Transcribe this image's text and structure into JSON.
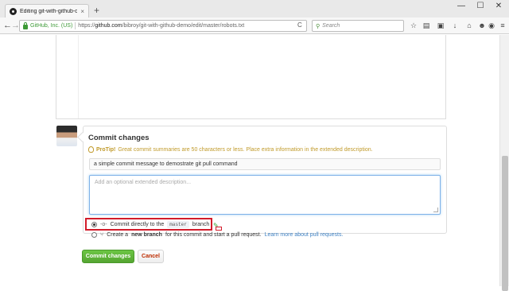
{
  "browser": {
    "tab_title": "Editing git-with-github-d...",
    "tab_close": "×",
    "new_tab": "+",
    "window_controls": {
      "minimize": "—",
      "maximize": "☐",
      "close": "✕"
    },
    "back": "←",
    "forward": "→",
    "identity": "GitHub, Inc. (US)",
    "url_prefix": "https://",
    "url_host": "github.com",
    "url_path": "/bibroy/git-with-github-demo/edit/master/robots.txt",
    "reload": "C",
    "search_placeholder": "Search",
    "toolbar_icons": [
      "star-icon",
      "reading-list-icon",
      "lock-box-icon",
      "download-icon",
      "home-icon",
      "chat-icon",
      "addon-icon",
      "menu-icon"
    ]
  },
  "commit": {
    "title": "Commit changes",
    "protip_label": "ProTip!",
    "protip_text": "Great commit summaries are 50 characters or less. Place extra information in the extended description.",
    "summary_value": "a simple commit message to demostrate git pull command",
    "description_placeholder": "Add an optional extended description...",
    "option_direct_prefix": "Commit directly to the",
    "option_direct_branch": "master",
    "option_direct_suffix": "branch",
    "option_new_prefix": "Create a",
    "option_new_bold": "new branch",
    "option_new_suffix": "for this commit and start a pull request.",
    "option_new_link": "Learn more about pull requests.",
    "commit_button": "Commit changes",
    "cancel_button": "Cancel"
  },
  "colors": {
    "commit_green": "#55a532",
    "cancel_red": "#bd2c00",
    "protip_gold": "#c09a2a",
    "highlight_red": "#d21c2b",
    "link_blue": "#4183c4"
  }
}
